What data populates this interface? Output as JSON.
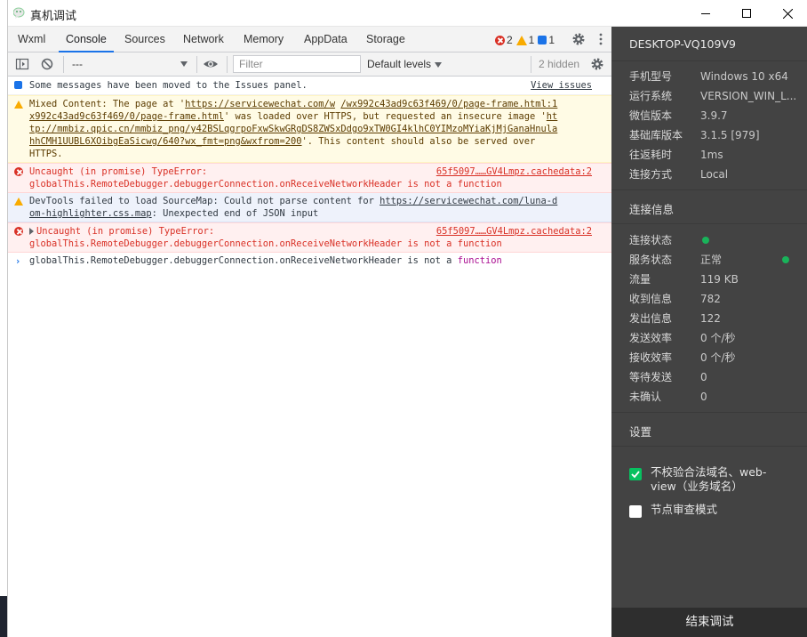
{
  "window": {
    "title": "真机调试"
  },
  "tabs": [
    {
      "label": "Wxml"
    },
    {
      "label": "Console"
    },
    {
      "label": "Sources"
    },
    {
      "label": "Network"
    },
    {
      "label": "Memory"
    },
    {
      "label": "AppData"
    },
    {
      "label": "Storage"
    }
  ],
  "active_tab": "Console",
  "counts": {
    "errors": "2",
    "warnings": "1",
    "info": "1"
  },
  "toolbar": {
    "context": "---",
    "filter_placeholder": "Filter",
    "levels": "Default levels",
    "hidden": "2 hidden"
  },
  "messages": {
    "m1": {
      "text": "Some messages have been moved to the Issues panel.",
      "link": "View issues"
    },
    "m2": {
      "pre": "Mixed Content: The page at '",
      "url1": "https://servicewechat.com/w",
      "url2": "/wx992c43ad9c63f469/0/page-frame.html:1",
      "url3": "x992c43ad9c63f469/0/page-frame.html",
      "mid": "' was loaded over HTTPS, but requested an insecure image '",
      "url4": "ht",
      "url5": "tp://mmbiz.qpic.cn/mmbiz_png/y42BSLqgrpoFxwSkwGRgDS8ZWSxDdgo9xTW0GI4klhC0YIMzoMYiaKjMjGanaHnula",
      "url6": "hhCMH1UUBL6XOibgEaSicwg/640?wx_fmt=png&wxfrom=200",
      "post": "'. This content should also be served over",
      "tail": "HTTPS."
    },
    "m3": {
      "line1": "Uncaught (in promise) TypeError:",
      "source": "65f5097……GV4Lmpz.cachedata:2",
      "line2": "globalThis.RemoteDebugger.debuggerConnection.onReceiveNetworkHeader is not a function"
    },
    "m4": {
      "pre": "DevTools failed to load SourceMap: Could not parse content for ",
      "url1": "https://servicewechat.com/luna-d",
      "url2": "om-highlighter.css.map",
      "post": ": Unexpected end of JSON input"
    },
    "m5": {
      "line1": "Uncaught (in promise) TypeError:",
      "source": "65f5097……GV4Lmpz.cachedata:2",
      "line2": "globalThis.RemoteDebugger.debuggerConnection.onReceiveNetworkHeader is not a function"
    },
    "m6": {
      "text": "globalThis.RemoteDebugger.debuggerConnection.onReceiveNetworkHeader is not a ",
      "kw": "function"
    }
  },
  "panel": {
    "device": "DESKTOP-VQ109V9",
    "info_rows": [
      {
        "k": "手机型号",
        "v": "Windows 10 x64"
      },
      {
        "k": "运行系统",
        "v": "VERSION_WIN_L..."
      },
      {
        "k": "微信版本",
        "v": "3.9.7"
      },
      {
        "k": "基础库版本",
        "v": "3.1.5 [979]"
      },
      {
        "k": "往返耗时",
        "v": "1ms"
      },
      {
        "k": "连接方式",
        "v": "Local"
      }
    ],
    "conn_title": "连接信息",
    "conn_rows": [
      {
        "k": "连接状态",
        "v": ""
      },
      {
        "k": "服务状态",
        "v": "正常"
      },
      {
        "k": "流量",
        "v": "119 KB"
      },
      {
        "k": "收到信息",
        "v": "782"
      },
      {
        "k": "发出信息",
        "v": "122"
      },
      {
        "k": "发送效率",
        "v": "0 个/秒"
      },
      {
        "k": "接收效率",
        "v": "0 个/秒"
      },
      {
        "k": "等待发送",
        "v": "0"
      },
      {
        "k": "未确认",
        "v": "0"
      }
    ],
    "settings_title": "设置",
    "option1": "不校验合法域名、web-view（业务域名）",
    "option1_checked": true,
    "option2": "节点审查模式",
    "option2_checked": false,
    "end_button": "结束调试",
    "status_color": "#19b35a",
    "checkbox_on_color": "#07c160"
  }
}
